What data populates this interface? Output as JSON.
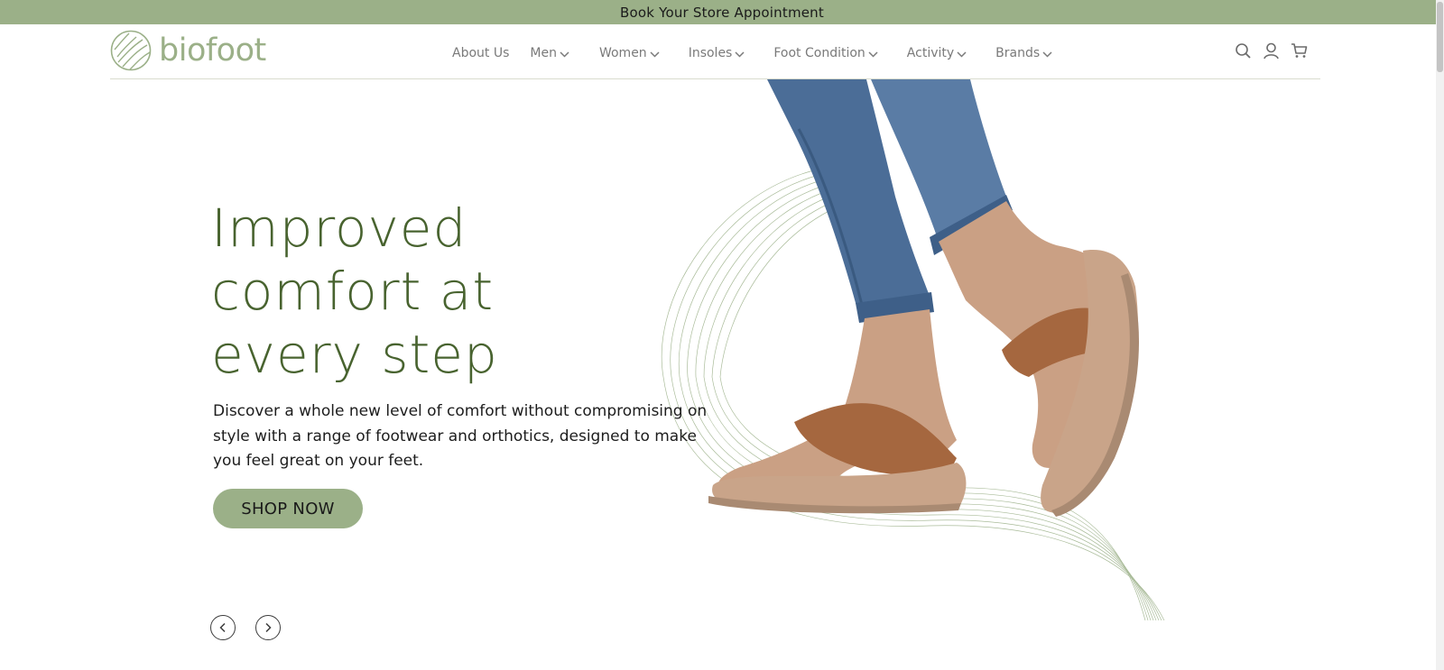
{
  "announcement": {
    "text": "Book Your Store Appointment"
  },
  "brand": {
    "name": "biofoot",
    "color": "#9bb088"
  },
  "nav": {
    "items": [
      {
        "label": "About Us",
        "has_dropdown": false
      },
      {
        "label": "Men",
        "has_dropdown": true
      },
      {
        "label": "Women",
        "has_dropdown": true
      },
      {
        "label": "Insoles",
        "has_dropdown": true
      },
      {
        "label": "Foot Condition",
        "has_dropdown": true
      },
      {
        "label": "Activity",
        "has_dropdown": true
      },
      {
        "label": "Brands",
        "has_dropdown": true
      }
    ],
    "icons": [
      "search-icon",
      "account-icon",
      "cart-icon"
    ]
  },
  "hero": {
    "title_lines": [
      "Improved",
      "comfort at",
      "every step"
    ],
    "subtitle": "Discover a whole new level of comfort without compromising on style with a range of footwear and orthotics, designed to make you feel great on your feet.",
    "cta_label": "SHOP NOW",
    "image": "woman-wearing-tan-leather-toe-post-sandals-with-jeans",
    "carousel_controls": [
      "previous-slide-icon",
      "next-slide-icon"
    ]
  },
  "colors": {
    "accent": "#9bb088",
    "heading": "#48632f",
    "text": "#1d1d1d",
    "nav_text": "#7a7a7a"
  }
}
